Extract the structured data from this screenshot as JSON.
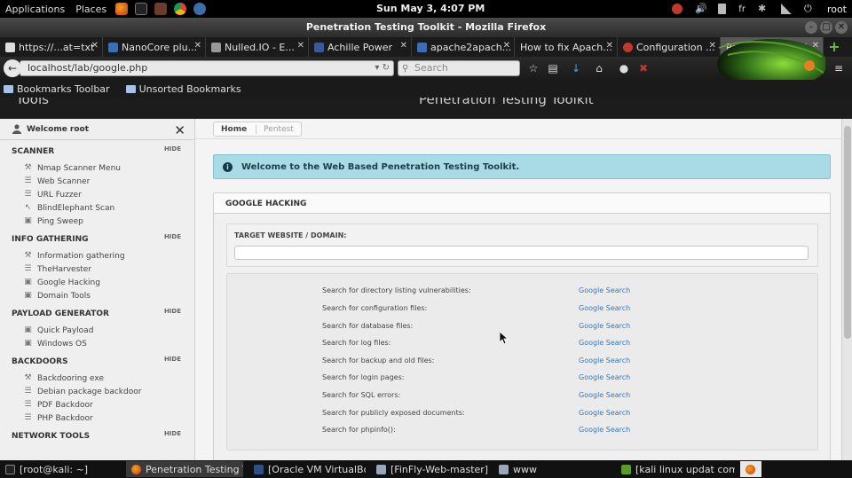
{
  "top_panel": {
    "applications": "Applications",
    "places": "Places",
    "clock": "Sun May  3,  4:07 PM",
    "keyboard": "fr",
    "user": "root"
  },
  "window": {
    "title": "Penetration Testing Toolkit - Mozilla Firefox"
  },
  "tabs": [
    {
      "label": "https://...at=txt",
      "active": false
    },
    {
      "label": "NanoCore plu...",
      "active": false
    },
    {
      "label": "Nulled.IO - E...",
      "active": false
    },
    {
      "label": "Achille Power",
      "active": false
    },
    {
      "label": "apache2apach...",
      "active": false
    },
    {
      "label": "How to fix Apach...",
      "active": false
    },
    {
      "label": "Configuration ...",
      "active": false
    },
    {
      "label": "Penetration Testi...",
      "active": true
    }
  ],
  "nav": {
    "url": "localhost/lab/google.php",
    "search_placeholder": "Search"
  },
  "bookmarks": {
    "toolbar": "Bookmarks Toolbar",
    "unsorted": "Unsorted Bookmarks"
  },
  "header": {
    "tools": "Tools",
    "title": "Penetration Testing Toolkit"
  },
  "sidebar": {
    "welcome": "Welcome root",
    "hide_label": "HIDE",
    "sections": [
      {
        "title": "SCANNER",
        "items": [
          "Nmap Scanner Menu",
          "Web Scanner",
          "URL Fuzzer",
          "BlindElephant Scan",
          "Ping Sweep"
        ]
      },
      {
        "title": "INFO GATHERING",
        "items": [
          "Information gathering",
          "TheHarvester",
          "Google Hacking",
          "Domain Tools"
        ]
      },
      {
        "title": "PAYLOAD GENERATOR",
        "items": [
          "Quick Payload",
          "Windows OS"
        ]
      },
      {
        "title": "BACKDOORS",
        "items": [
          "Backdooring exe",
          "Debian package backdoor",
          "PDF Backdoor",
          "PHP Backdoor"
        ]
      },
      {
        "title": "NETWORK TOOLS",
        "items": []
      }
    ]
  },
  "breadcrumb": {
    "home": "Home",
    "current": "Pentest"
  },
  "alert": {
    "text": "Welcome to the Web Based Penetration Testing Toolkit."
  },
  "google_hacking": {
    "title": "GOOGLE HACKING",
    "target_label": "TARGET WEBSITE / DOMAIN:",
    "target_value": "",
    "link_label": "Google Search",
    "rows": [
      "Search for directory listing vulnerabilities:",
      "Search for configuration files:",
      "Search for database files:",
      "Search for log files:",
      "Search for backup and old files:",
      "Search for login pages:",
      "Search for SQL errors:",
      "Search for publicly exposed documents:",
      "Search for phpinfo():"
    ]
  },
  "taskbar": [
    {
      "label": "[root@kali: ~]",
      "active": false
    },
    {
      "label": "Penetration Testing T...",
      "active": true
    },
    {
      "label": "[Oracle VM VirtualBo...",
      "active": false
    },
    {
      "label": "[FinFly-Web-master]",
      "active": false
    },
    {
      "label": "www",
      "active": false
    },
    {
      "label": "[kali linux updat com...",
      "active": false
    }
  ]
}
